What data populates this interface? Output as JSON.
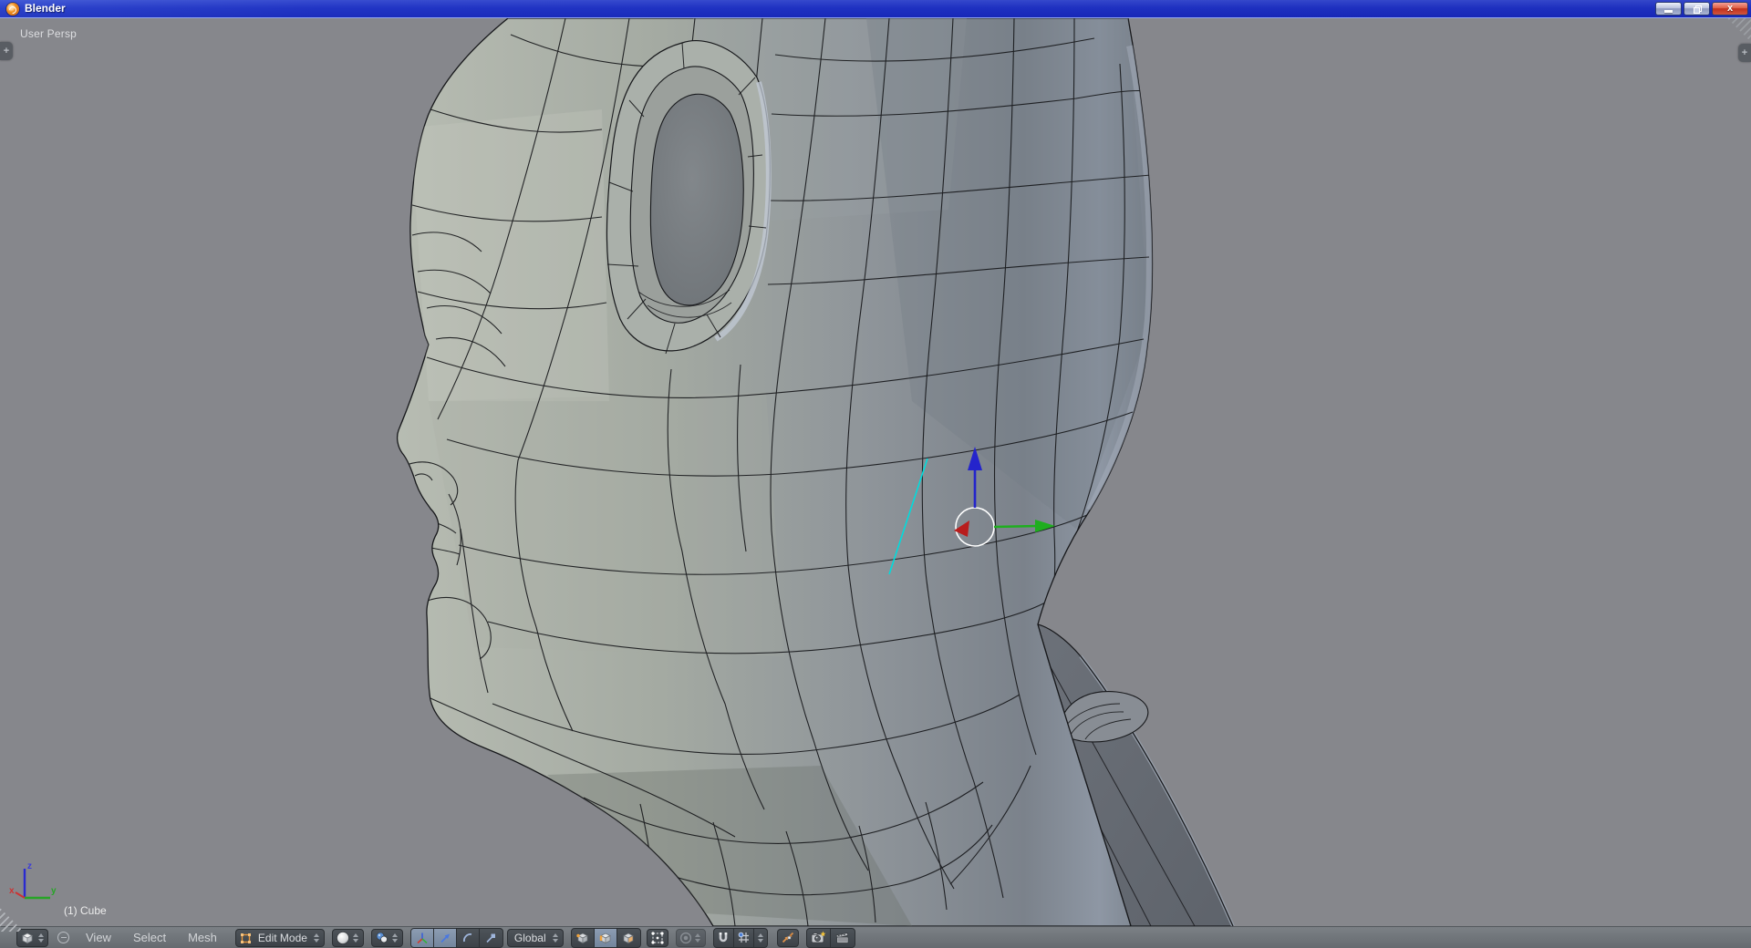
{
  "window": {
    "title": "Blender",
    "controls": [
      "minimize",
      "restore",
      "close"
    ]
  },
  "viewport": {
    "view_label": "User Persp",
    "object_info": "(1) Cube",
    "axis": {
      "x": "x",
      "y": "y",
      "z": "z"
    },
    "region_tab_glyph": "+"
  },
  "header": {
    "editor_type_icon": "3d-view-editor",
    "menus": [
      {
        "label": "View"
      },
      {
        "label": "Select"
      },
      {
        "label": "Mesh"
      }
    ],
    "mode_label": "Edit Mode",
    "shading_icon": "viewport-shading-solid-sphere",
    "pivot_icon": "pivot-median-point",
    "manipulator": [
      "axes",
      "translate",
      "rotate",
      "scale"
    ],
    "manipulator_active": [
      "axes",
      "translate"
    ],
    "orientation_label": "Global",
    "select_modes": [
      "vertex",
      "edge",
      "face"
    ],
    "select_mode_active": "edge",
    "toggles": [
      "occlude-background-geometry",
      "proportional-edit-disabled",
      "snap-magnet-on",
      "snap-element",
      "snap-target"
    ],
    "render_buttons": [
      "opengl-render-still",
      "opengl-render-animation"
    ]
  },
  "colors": {
    "titlebar_blue": "#2136c8",
    "close_button_red": "#cf3a28",
    "viewport_background": "#86878c",
    "mesh_light": "#b4b9b0",
    "mesh_dark": "#70767e",
    "wireframe": "#17181b",
    "selected_edge_cyan": "#00dcdc",
    "gizmo_x_red": "#c02020",
    "gizmo_y_green": "#1fae1f",
    "gizmo_z_blue": "#2424cc",
    "active_button_blue": "#7e8ea4",
    "edit_mode_orange": "#e8973c"
  }
}
